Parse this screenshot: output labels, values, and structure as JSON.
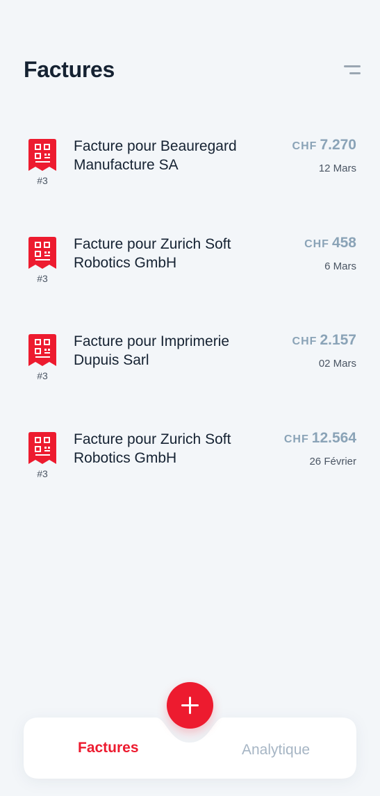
{
  "header": {
    "title": "Factures",
    "menu_icon": "menu-lines-icon"
  },
  "invoices": [
    {
      "number": "#3",
      "title": "Facture pour Beauregard Manufacture SA",
      "currency": "CHF",
      "amount": "7.270",
      "date": "12 Mars"
    },
    {
      "number": "#3",
      "title": "Facture pour Zurich Soft Robotics GmbH",
      "currency": "CHF",
      "amount": "458",
      "date": "6 Mars"
    },
    {
      "number": "#3",
      "title": "Facture pour Imprimerie Dupuis Sarl",
      "currency": "CHF",
      "amount": "2.157",
      "date": "02 Mars"
    },
    {
      "number": "#3",
      "title": "Facture pour Zurich Soft Robotics GmbH",
      "currency": "CHF",
      "amount": "12.564",
      "date": "26 Février"
    }
  ],
  "bottom_nav": {
    "tabs": [
      {
        "label": "Factures",
        "active": true
      },
      {
        "label": "Analytique",
        "active": false
      }
    ],
    "fab_icon": "plus-icon"
  },
  "colors": {
    "accent": "#ed1b2f",
    "background": "#f3f6f9",
    "amount": "#8aa3b7",
    "text_dark": "#152232",
    "tab_inactive": "#a6b5c4"
  }
}
